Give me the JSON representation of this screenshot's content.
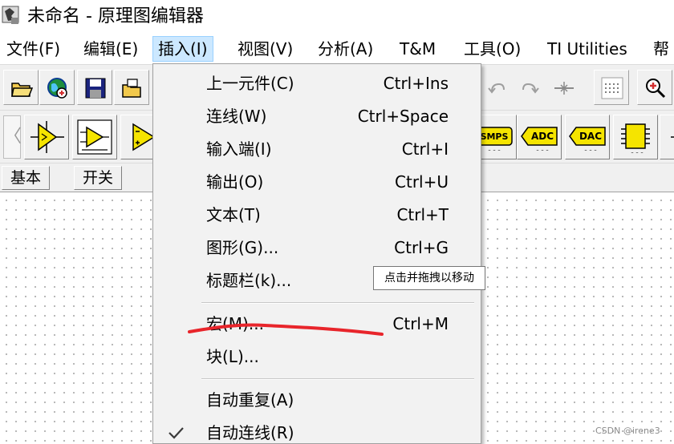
{
  "window": {
    "title": "未命名 - 原理图编辑器"
  },
  "menubar": {
    "items": [
      {
        "label": "文件(F)"
      },
      {
        "label": "编辑(E)"
      },
      {
        "label": "插入(I)",
        "active": true
      },
      {
        "label": "视图(V)"
      },
      {
        "label": "分析(A)"
      },
      {
        "label": "T&M"
      },
      {
        "label": "工具(O)"
      },
      {
        "label": "TI Utilities"
      },
      {
        "label": "帮"
      }
    ]
  },
  "toolbar_icons": [
    "open-folder-icon",
    "globe-icon",
    "save-icon",
    "open-file-icon",
    "undo-icon",
    "redo-icon",
    "wire-tool-icon",
    "grid-icon",
    "zoom-in-icon"
  ],
  "parts_toolbar": {
    "scroll_left_label": "〈",
    "badges": {
      "smps": "SMPS",
      "adc": "ADC",
      "dac": "DAC"
    }
  },
  "part_tabs": [
    {
      "label": "基本"
    },
    {
      "label": "开关"
    }
  ],
  "insert_menu": {
    "items": [
      {
        "label": "上一元件(C)",
        "shortcut": "Ctrl+Ins"
      },
      {
        "label": "连线(W)",
        "shortcut": "Ctrl+Space"
      },
      {
        "label": "输入端(I)",
        "shortcut": "Ctrl+I"
      },
      {
        "label": "输出(O)",
        "shortcut": "Ctrl+U"
      },
      {
        "label": "文本(T)",
        "shortcut": "Ctrl+T"
      },
      {
        "label": "图形(G)...",
        "shortcut": "Ctrl+G"
      },
      {
        "label": "标题栏(k)...",
        "shortcut": ""
      },
      {
        "label": "宏(M)...",
        "shortcut": "Ctrl+M"
      },
      {
        "label": "块(L)...",
        "shortcut": ""
      },
      {
        "label": "自动重复(A)",
        "shortcut": ""
      },
      {
        "label": "自动连线(R)",
        "shortcut": "",
        "checked": true
      }
    ]
  },
  "tooltip": {
    "text": "点击并拖拽以移动"
  },
  "watermark": {
    "text": "CSDN @irene3"
  },
  "colors": {
    "menu_highlight": "#cce8ff",
    "annotation_red": "#e8252b",
    "part_yellow": "#f5e400"
  }
}
